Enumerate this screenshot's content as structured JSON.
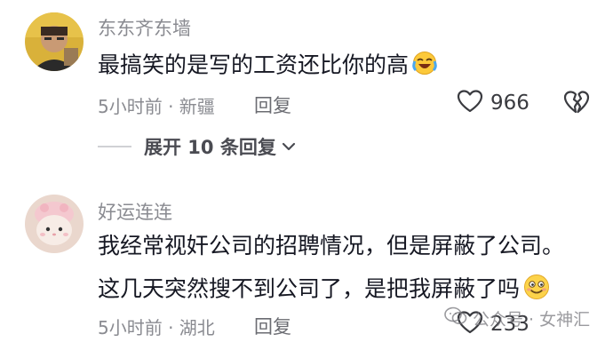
{
  "comments": [
    {
      "username": "东东齐东墙",
      "lines": [
        "最搞笑的是写的工资还比你的高"
      ],
      "time_location": "5小时前 · 新疆",
      "reply_label": "回复",
      "likes": "966",
      "expand_label": "展开 10 条回复"
    },
    {
      "username": "好运连连",
      "lines": [
        "我经常视奸公司的招聘情况，但是屏蔽了公司。",
        "这几天突然搜不到公司了，是把我屏蔽了吗"
      ],
      "time_location": "5小时前 · 湖北",
      "reply_label": "回复",
      "likes": "233"
    }
  ],
  "watermark": "公众号 · 女神汇",
  "colors": {
    "meta_gray": "#8a8b91",
    "text": "#161823"
  },
  "icons": {
    "like": "heart-outline-icon",
    "dislike": "broken-heart-icon",
    "expand": "chevron-down-icon",
    "emoji_1": "laughing-crying-emoji-icon",
    "emoji_2": "smiling-emoji-icon"
  }
}
